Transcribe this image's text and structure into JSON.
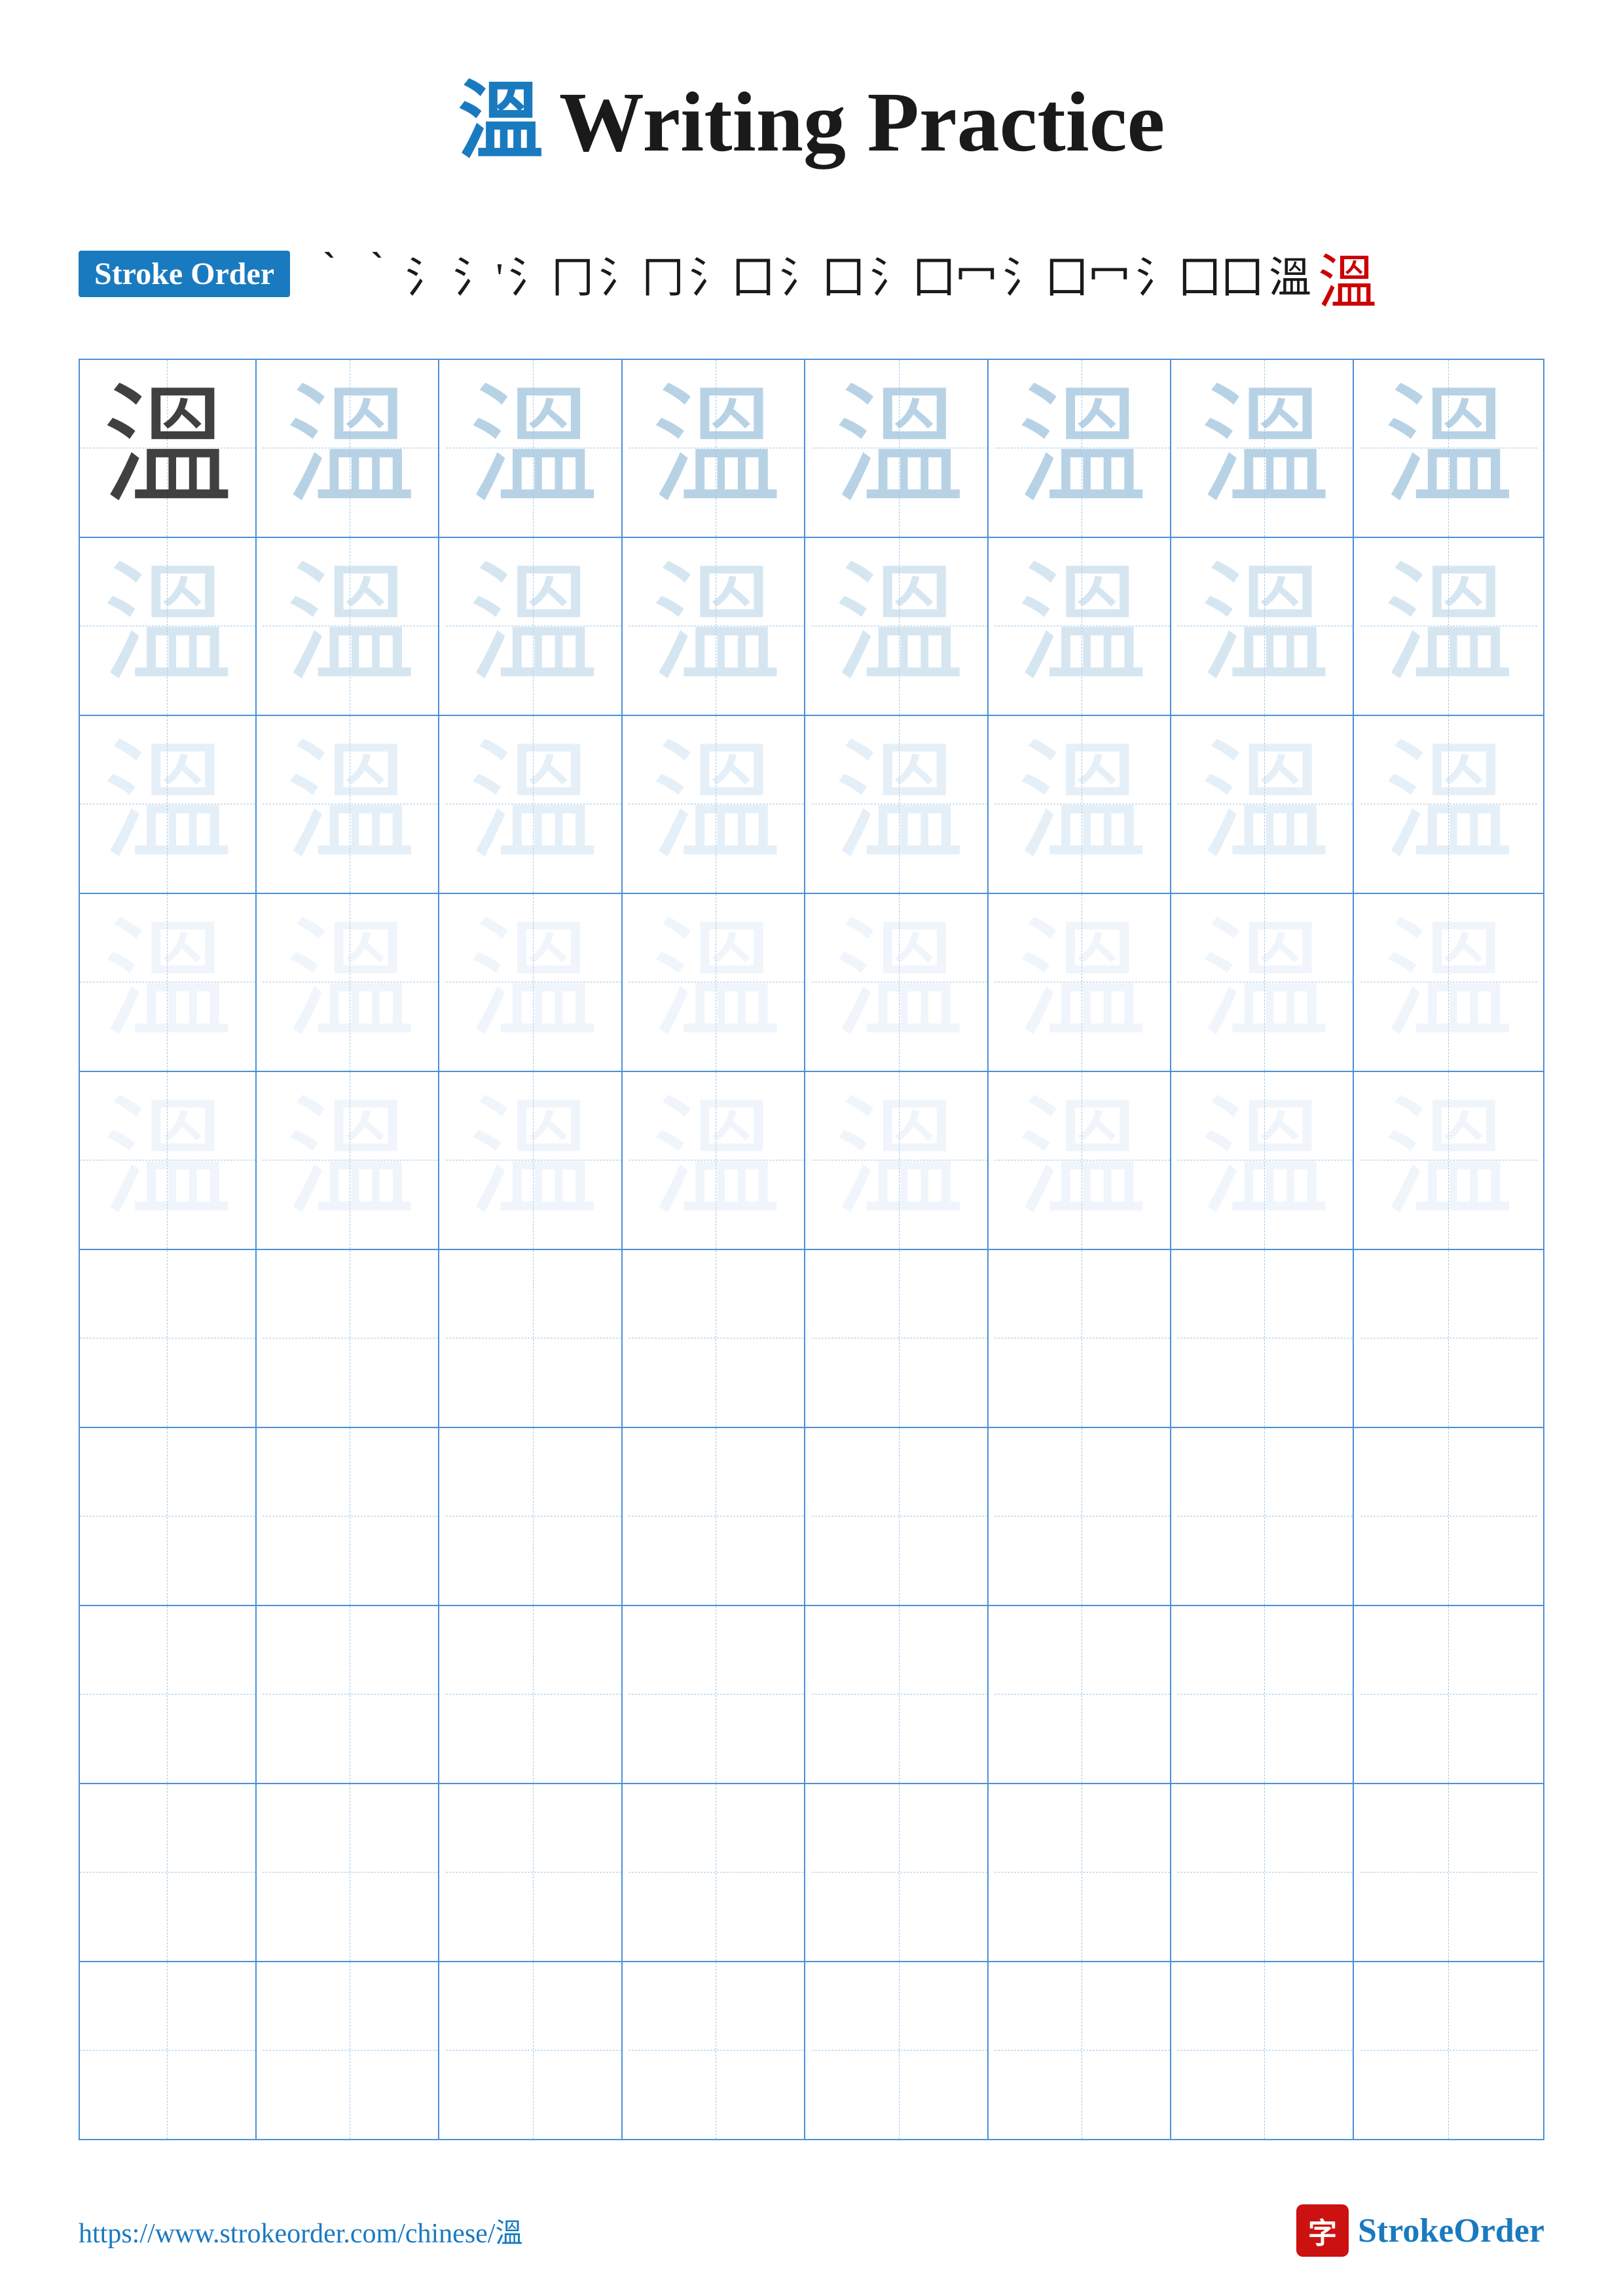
{
  "title": {
    "char": "溫",
    "text": "Writing Practice"
  },
  "stroke_order": {
    "badge": "Stroke Order",
    "strokes": [
      "、",
      "、",
      "氵",
      "氵'",
      "氵冂",
      "氵冂冂",
      "氵冂囗",
      "氵冂囗",
      "氵冂囗冖",
      "氵囗囗冖",
      "氵囗囗冖",
      "溫"
    ],
    "strokes_display": [
      "｀",
      "｀",
      "氵",
      "氵'",
      "氵冂",
      "氵冂",
      "氵囗",
      "氵囗",
      "氵囗冖",
      "氵囗冖",
      "氵囗囗",
      "溫"
    ],
    "final_char": "溫"
  },
  "practice": {
    "character": "溫",
    "rows": 10,
    "cols": 8,
    "guide_rows": 5,
    "blank_rows": 5
  },
  "footer": {
    "url": "https://www.strokeorder.com/chinese/溫",
    "brand_icon": "字",
    "brand_name": "StrokeOrder"
  }
}
